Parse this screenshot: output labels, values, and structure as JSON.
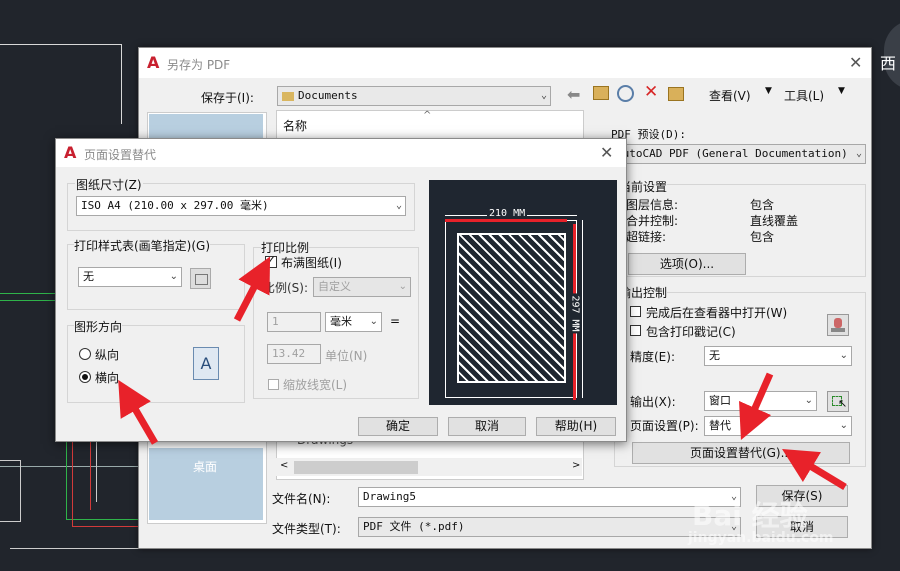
{
  "background": {
    "corner_text": "西"
  },
  "save_dialog": {
    "title": "另存为 PDF",
    "save_in_label": "保存于(I):",
    "save_in_value": "Documents",
    "view_menu": "查看(V)",
    "tools_menu": "工具(L)",
    "file_list_header": "名称",
    "file_list_partial_item": "Drawings",
    "places_desktop": "桌面",
    "pdf_preset_label": "PDF 预设(D):",
    "pdf_preset_value": "AutoCAD PDF (General Documentation)",
    "current_settings_title": "当前设置",
    "settings": [
      {
        "label": "图层信息:",
        "value": "包含"
      },
      {
        "label": "合并控制:",
        "value": "直线覆盖"
      },
      {
        "label": "超链接:",
        "value": "包含"
      }
    ],
    "options_button": "选项(O)...",
    "output_control_title": "输出控制",
    "open_in_viewer": "完成后在查看器中打开(W)",
    "include_plot_stamp": "包含打印戳记(C)",
    "precision_label": "精度(E):",
    "precision_value": "无",
    "output_label": "输出(X):",
    "output_value": "窗口",
    "page_setup_label": "页面设置(P):",
    "page_setup_value": "替代",
    "page_setup_override_button": "页面设置替代(G)...",
    "file_name_label": "文件名(N):",
    "file_name_value": "Drawing5",
    "file_type_label": "文件类型(T):",
    "file_type_value": "PDF 文件 (*.pdf)",
    "save_button": "保存(S)",
    "cancel_button": "取消"
  },
  "page_setup_dialog": {
    "title": "页面设置替代",
    "paper_size_label": "图纸尺寸(Z)",
    "paper_size_value": "ISO A4 (210.00 x 297.00 毫米)",
    "plot_style_label": "打印样式表(画笔指定)(G)",
    "plot_style_value": "无",
    "orientation_label": "图形方向",
    "portrait": "纵向",
    "landscape": "横向",
    "orientation_selected": "landscape",
    "plot_scale_label": "打印比例",
    "fit_to_paper": "布满图纸(I)",
    "fit_to_paper_checked": true,
    "scale_label": "比例(S):",
    "scale_value": "自定义",
    "scale_num": "1",
    "unit_value": "毫米",
    "scale_den": "13.42",
    "unit_label": "单位(N)",
    "scale_lineweights": "缩放线宽(L)",
    "preview_width": "210 MM",
    "preview_height": "297 MM",
    "ok_button": "确定",
    "cancel_button": "取消",
    "help_button": "帮助(H)",
    "equals": "="
  },
  "watermark": {
    "text": "Bai 经验",
    "url": "jingyan.baidu.com"
  },
  "colors": {
    "annotation_red": "#e8222a",
    "preview_bg": "#1f2630"
  }
}
